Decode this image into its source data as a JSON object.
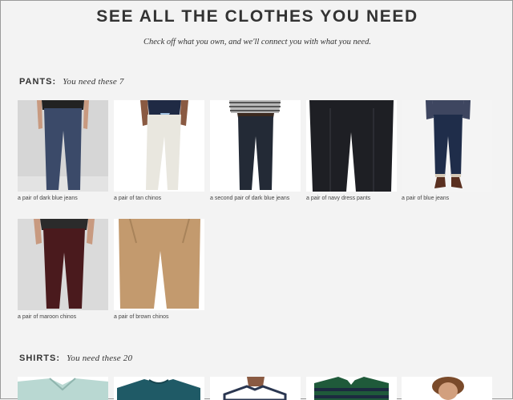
{
  "header": {
    "title": "SEE ALL THE CLOTHES YOU NEED",
    "subtitle": "Check off what you own, and we'll connect you with what you need."
  },
  "sections": [
    {
      "name": "PANTS:",
      "need_text": "You need these 7",
      "items": [
        {
          "caption": "a pair of dark blue jeans",
          "bg": "#d9d9d9",
          "pants": "#3b4a69",
          "shirt": "#222222",
          "skin": "#c89a80"
        },
        {
          "caption": "a pair of tan chinos",
          "bg": "#ffffff",
          "pants": "#e9e7df",
          "shirt": "#1f2a44",
          "skin": "#8a5a42"
        },
        {
          "caption": "a second pair of dark blue jeans",
          "bg": "#ffffff",
          "pants": "#232a36",
          "shirt": "#b9b9b9",
          "skin": "#d2a58b"
        },
        {
          "caption": "a pair of navy dress pants",
          "bg": "#ffffff",
          "pants": "#1e1f24",
          "shirt": "#1e1f24",
          "skin": "#ffffff"
        },
        {
          "caption": "a pair of blue jeans",
          "bg": "#f4f4f4",
          "pants": "#1f2d4a",
          "shirt": "#3e4660",
          "skin": "#c99a80"
        }
      ],
      "items_row2": [
        {
          "caption": "a pair of maroon chinos",
          "bg": "#dcdcdc",
          "pants": "#4a1a1d",
          "shirt": "#2b2b2b",
          "skin": "#c89a80"
        },
        {
          "caption": "a pair of brown chinos",
          "bg": "#ffffff",
          "pants": "#c39a6e",
          "shirt": "#c39a6e",
          "skin": "#ffffff"
        }
      ]
    },
    {
      "name": "SHIRTS:",
      "need_text": "You need these 20",
      "items": [
        {
          "caption": "",
          "shirt": "#b9d8d2"
        },
        {
          "caption": "",
          "shirt": "#1f5a66"
        },
        {
          "caption": "",
          "shirt": "#ffffff"
        },
        {
          "caption": "",
          "shirt": "#1f5a3a"
        },
        {
          "caption": "",
          "shirt": "#ffffff"
        }
      ]
    }
  ]
}
